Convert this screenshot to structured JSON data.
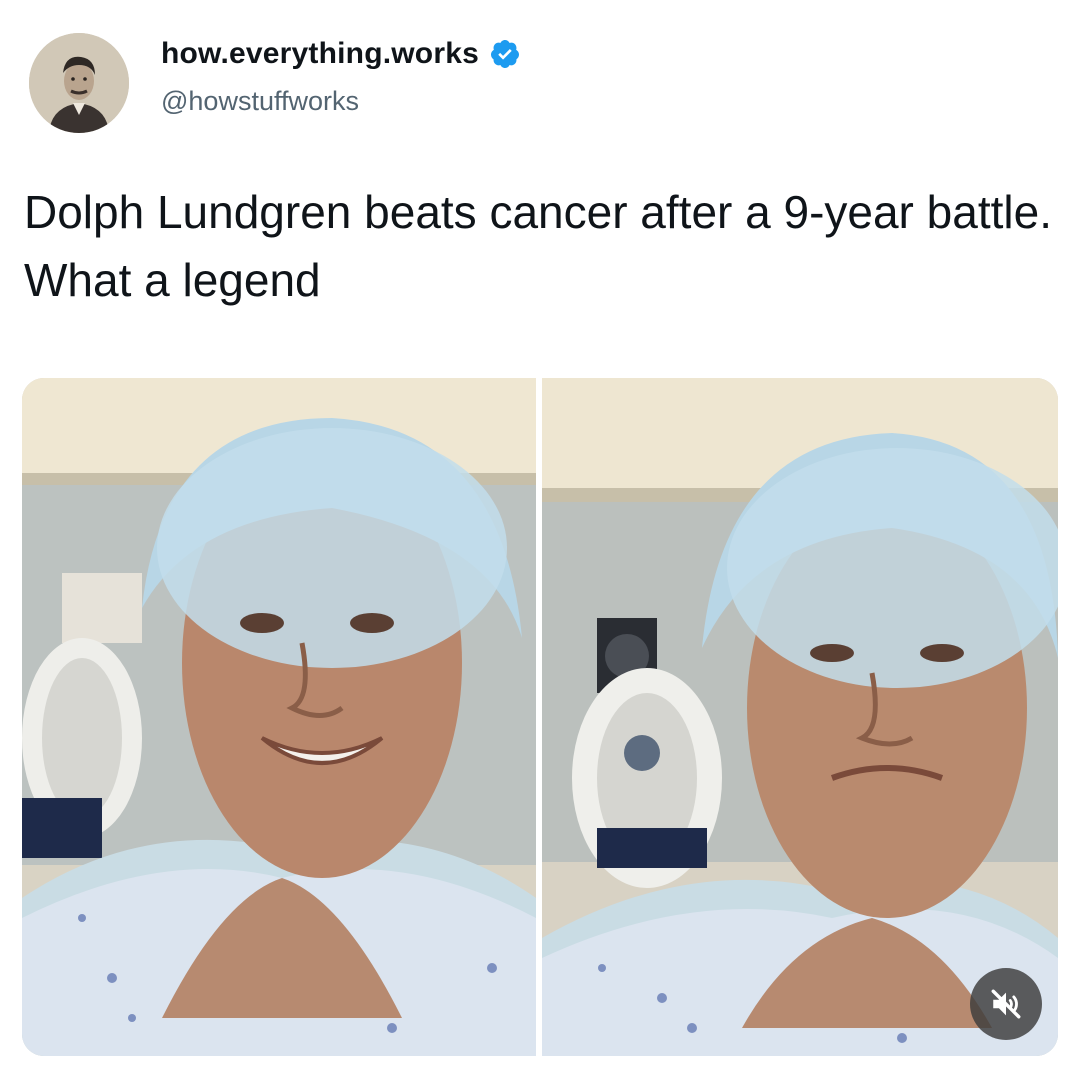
{
  "post": {
    "author": {
      "display_name": "how.everything.works",
      "handle": "@howstuffworks",
      "verified": true,
      "verified_color": "#1d9bf0"
    },
    "text": "Dolph Lundgren beats cancer after a 9-year battle. What a legend",
    "media": {
      "panels": [
        "hospital-selfie-talking",
        "hospital-selfie-emotional"
      ],
      "controls": {
        "mute_icon": "speaker-muted-icon"
      }
    }
  }
}
